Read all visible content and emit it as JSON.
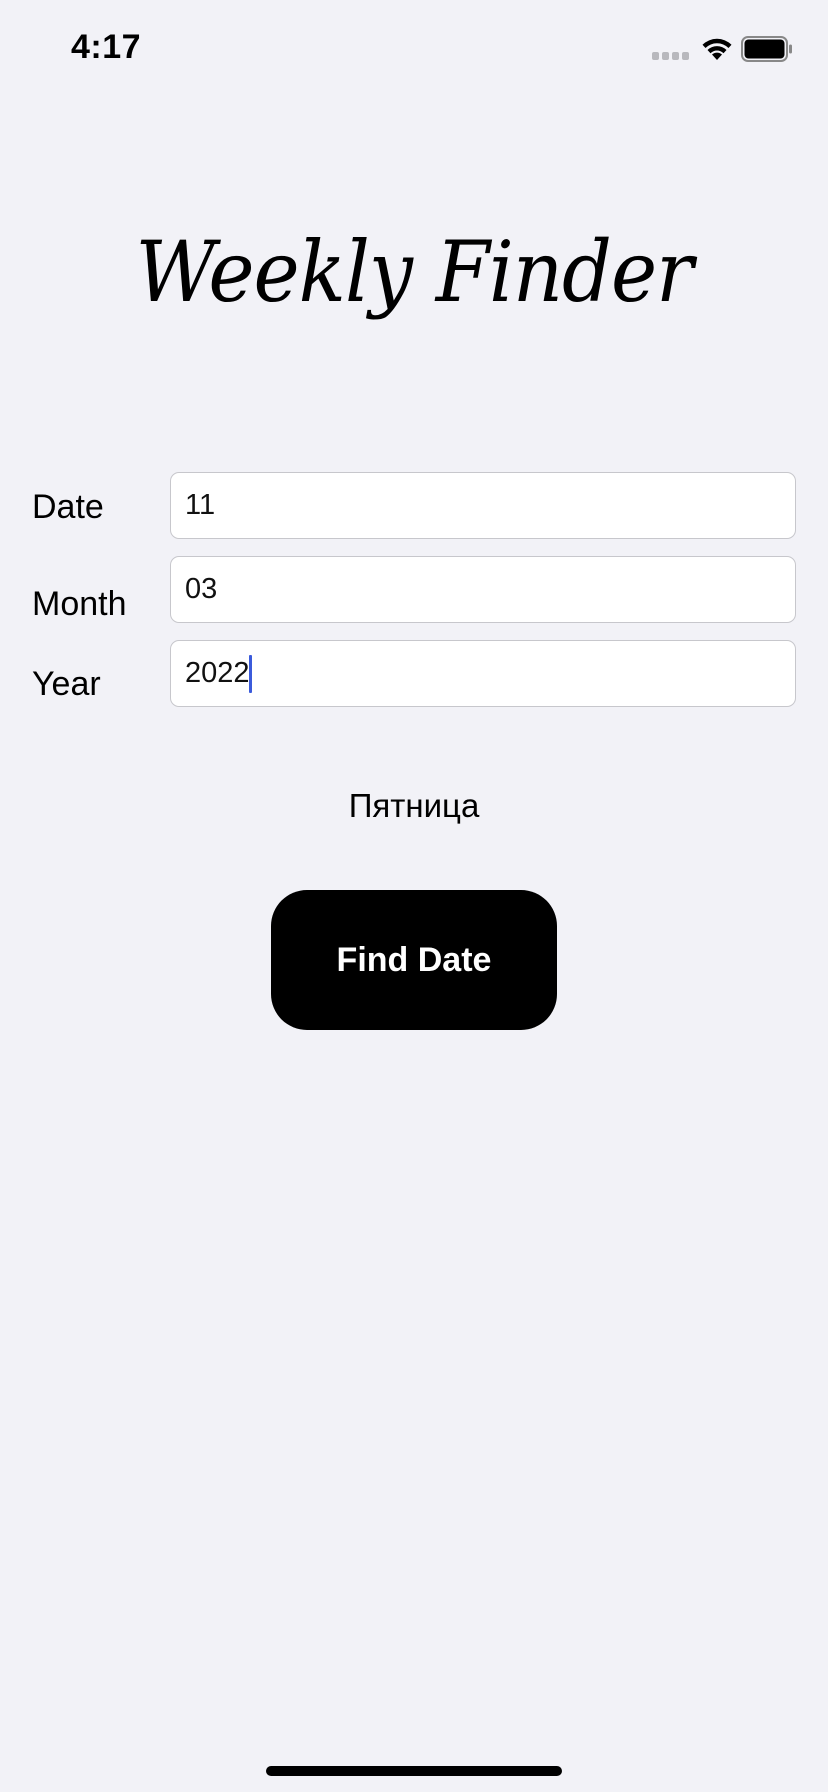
{
  "status_bar": {
    "time": "4:17"
  },
  "app": {
    "title": "Weekly Finder"
  },
  "form": {
    "date_label": "Date",
    "date_value": "11",
    "month_label": "Month",
    "month_value": "03",
    "year_label": "Year",
    "year_value": "2022"
  },
  "result": {
    "text": "Пятница"
  },
  "button": {
    "label": "Find Date"
  },
  "colors": {
    "background": "#f2f2f7",
    "button_bg": "#000000",
    "button_text": "#ffffff",
    "caret": "#3b5bdb"
  }
}
